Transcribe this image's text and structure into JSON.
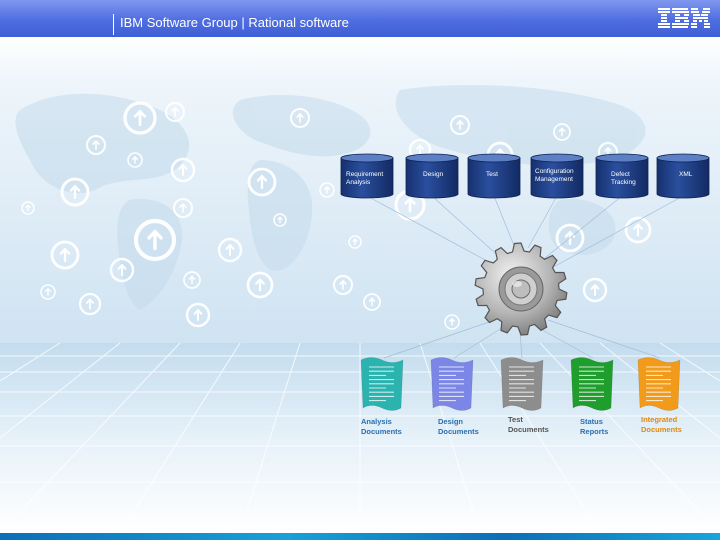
{
  "header": {
    "title": "IBM Software Group | Rational software",
    "logo": "IBM"
  },
  "databases": [
    {
      "label": "Requirement\nAnalysis"
    },
    {
      "label": "Design"
    },
    {
      "label": "Test"
    },
    {
      "label": "Configuration\nManagement"
    },
    {
      "label": "Defect\nTracking"
    },
    {
      "label": "XML"
    }
  ],
  "engine_icon": "gear-icon",
  "documents": [
    {
      "label": "Analysis\nDocuments",
      "color": "#2bb3b0",
      "label_color": "#2a6fb0"
    },
    {
      "label": "Design\nDocuments",
      "color": "#7b86e6",
      "label_color": "#2a6fb0"
    },
    {
      "label": "Test\nDocuments",
      "color": "#8d8d8d",
      "label_color": "#555555"
    },
    {
      "label": "Status\nReports",
      "color": "#1f9e2e",
      "label_color": "#2a6fb0"
    },
    {
      "label": "Integrated\nDocuments",
      "color": "#f29a1a",
      "label_color": "#e08a10"
    }
  ],
  "colors": {
    "header": "#4e6de0",
    "database": "#1e3f8a",
    "sky": "#dbeaf5"
  }
}
